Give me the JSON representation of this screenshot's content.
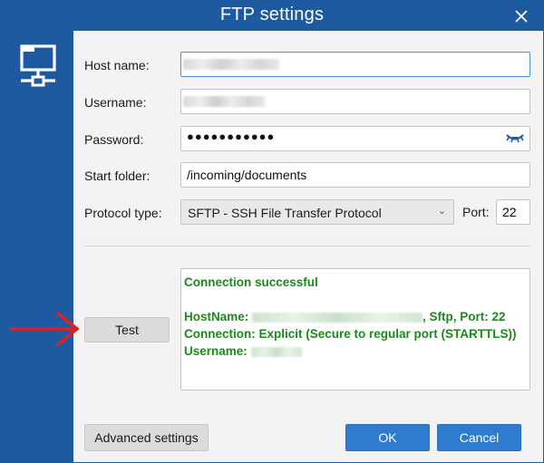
{
  "window": {
    "title": "FTP settings"
  },
  "icons": {
    "close": "close-icon",
    "network": "network-computer-icon",
    "password_reveal": "eye-closed-icon",
    "dropdown": "chevron-down-icon",
    "annotation_arrow": "red-arrow-icon"
  },
  "form": {
    "host_label": "Host name:",
    "host_value": "",
    "username_label": "Username:",
    "username_value": "",
    "password_label": "Password:",
    "password_dots": "●●●●●●●●●●●",
    "start_folder_label": "Start folder:",
    "start_folder_value": "/incoming/documents",
    "protocol_label": "Protocol type:",
    "protocol_value": "SFTP - SSH File Transfer Protocol",
    "port_label": "Port:",
    "port_value": "22"
  },
  "test": {
    "button_label": "Test",
    "result_line1": "Connection successful",
    "result_hostname_prefix": "HostName: ",
    "result_hostname_suffix": ", Sftp, Port: 22",
    "result_connection": "Connection: Explicit (Secure to regular port (STARTTLS))",
    "result_username_prefix": "Username: "
  },
  "footer": {
    "advanced_label": "Advanced settings",
    "ok_label": "OK",
    "cancel_label": "Cancel"
  },
  "colors": {
    "accent": "#1d5aa0",
    "primary_button": "#2f7bd0",
    "success_text": "#1a8a1a",
    "annotation_arrow": "#e02020"
  }
}
